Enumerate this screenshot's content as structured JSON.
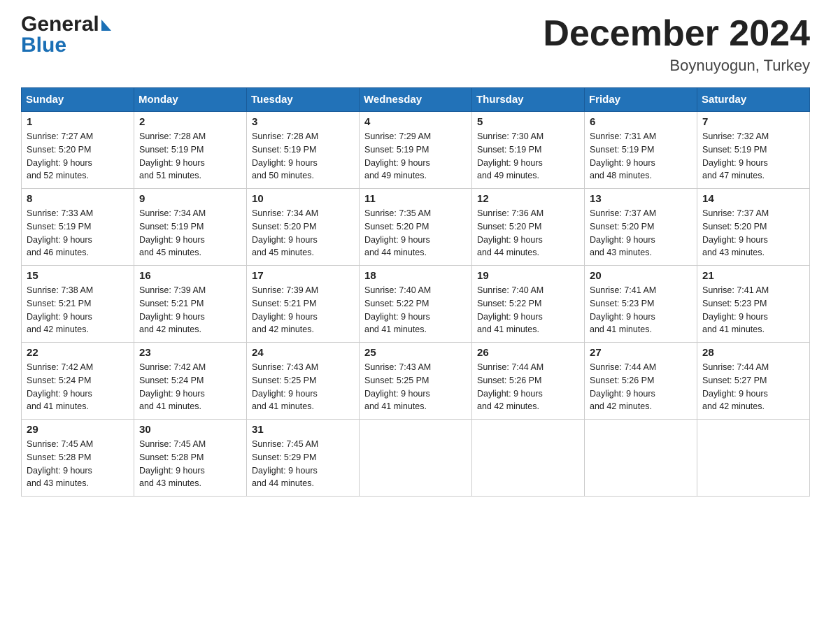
{
  "header": {
    "logo_general": "General",
    "logo_blue": "Blue",
    "month_title": "December 2024",
    "location": "Boynuyogun, Turkey"
  },
  "days_of_week": [
    "Sunday",
    "Monday",
    "Tuesday",
    "Wednesday",
    "Thursday",
    "Friday",
    "Saturday"
  ],
  "weeks": [
    [
      {
        "day": "1",
        "sunrise": "7:27 AM",
        "sunset": "5:20 PM",
        "daylight": "9 hours and 52 minutes."
      },
      {
        "day": "2",
        "sunrise": "7:28 AM",
        "sunset": "5:19 PM",
        "daylight": "9 hours and 51 minutes."
      },
      {
        "day": "3",
        "sunrise": "7:28 AM",
        "sunset": "5:19 PM",
        "daylight": "9 hours and 50 minutes."
      },
      {
        "day": "4",
        "sunrise": "7:29 AM",
        "sunset": "5:19 PM",
        "daylight": "9 hours and 49 minutes."
      },
      {
        "day": "5",
        "sunrise": "7:30 AM",
        "sunset": "5:19 PM",
        "daylight": "9 hours and 49 minutes."
      },
      {
        "day": "6",
        "sunrise": "7:31 AM",
        "sunset": "5:19 PM",
        "daylight": "9 hours and 48 minutes."
      },
      {
        "day": "7",
        "sunrise": "7:32 AM",
        "sunset": "5:19 PM",
        "daylight": "9 hours and 47 minutes."
      }
    ],
    [
      {
        "day": "8",
        "sunrise": "7:33 AM",
        "sunset": "5:19 PM",
        "daylight": "9 hours and 46 minutes."
      },
      {
        "day": "9",
        "sunrise": "7:34 AM",
        "sunset": "5:19 PM",
        "daylight": "9 hours and 45 minutes."
      },
      {
        "day": "10",
        "sunrise": "7:34 AM",
        "sunset": "5:20 PM",
        "daylight": "9 hours and 45 minutes."
      },
      {
        "day": "11",
        "sunrise": "7:35 AM",
        "sunset": "5:20 PM",
        "daylight": "9 hours and 44 minutes."
      },
      {
        "day": "12",
        "sunrise": "7:36 AM",
        "sunset": "5:20 PM",
        "daylight": "9 hours and 44 minutes."
      },
      {
        "day": "13",
        "sunrise": "7:37 AM",
        "sunset": "5:20 PM",
        "daylight": "9 hours and 43 minutes."
      },
      {
        "day": "14",
        "sunrise": "7:37 AM",
        "sunset": "5:20 PM",
        "daylight": "9 hours and 43 minutes."
      }
    ],
    [
      {
        "day": "15",
        "sunrise": "7:38 AM",
        "sunset": "5:21 PM",
        "daylight": "9 hours and 42 minutes."
      },
      {
        "day": "16",
        "sunrise": "7:39 AM",
        "sunset": "5:21 PM",
        "daylight": "9 hours and 42 minutes."
      },
      {
        "day": "17",
        "sunrise": "7:39 AM",
        "sunset": "5:21 PM",
        "daylight": "9 hours and 42 minutes."
      },
      {
        "day": "18",
        "sunrise": "7:40 AM",
        "sunset": "5:22 PM",
        "daylight": "9 hours and 41 minutes."
      },
      {
        "day": "19",
        "sunrise": "7:40 AM",
        "sunset": "5:22 PM",
        "daylight": "9 hours and 41 minutes."
      },
      {
        "day": "20",
        "sunrise": "7:41 AM",
        "sunset": "5:23 PM",
        "daylight": "9 hours and 41 minutes."
      },
      {
        "day": "21",
        "sunrise": "7:41 AM",
        "sunset": "5:23 PM",
        "daylight": "9 hours and 41 minutes."
      }
    ],
    [
      {
        "day": "22",
        "sunrise": "7:42 AM",
        "sunset": "5:24 PM",
        "daylight": "9 hours and 41 minutes."
      },
      {
        "day": "23",
        "sunrise": "7:42 AM",
        "sunset": "5:24 PM",
        "daylight": "9 hours and 41 minutes."
      },
      {
        "day": "24",
        "sunrise": "7:43 AM",
        "sunset": "5:25 PM",
        "daylight": "9 hours and 41 minutes."
      },
      {
        "day": "25",
        "sunrise": "7:43 AM",
        "sunset": "5:25 PM",
        "daylight": "9 hours and 41 minutes."
      },
      {
        "day": "26",
        "sunrise": "7:44 AM",
        "sunset": "5:26 PM",
        "daylight": "9 hours and 42 minutes."
      },
      {
        "day": "27",
        "sunrise": "7:44 AM",
        "sunset": "5:26 PM",
        "daylight": "9 hours and 42 minutes."
      },
      {
        "day": "28",
        "sunrise": "7:44 AM",
        "sunset": "5:27 PM",
        "daylight": "9 hours and 42 minutes."
      }
    ],
    [
      {
        "day": "29",
        "sunrise": "7:45 AM",
        "sunset": "5:28 PM",
        "daylight": "9 hours and 43 minutes."
      },
      {
        "day": "30",
        "sunrise": "7:45 AM",
        "sunset": "5:28 PM",
        "daylight": "9 hours and 43 minutes."
      },
      {
        "day": "31",
        "sunrise": "7:45 AM",
        "sunset": "5:29 PM",
        "daylight": "9 hours and 44 minutes."
      },
      null,
      null,
      null,
      null
    ]
  ],
  "sunrise_label": "Sunrise:",
  "sunset_label": "Sunset:",
  "daylight_label": "Daylight:"
}
